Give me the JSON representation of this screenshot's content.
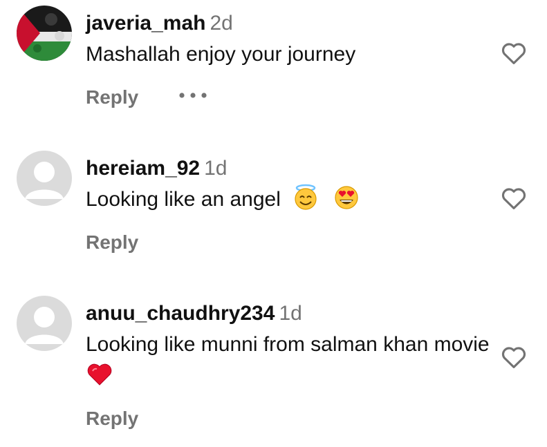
{
  "comments": [
    {
      "username": "javeria_mah",
      "time": "2d",
      "text": "Mashallah enjoy your journey",
      "reply_label": "Reply",
      "avatar": "flag-avatar",
      "has_more": true
    },
    {
      "username": "hereiam_92",
      "time": "1d",
      "text": "Looking like an angel",
      "emojis": [
        "smiling-face-with-halo-emoji",
        "heart-eyes-emoji"
      ],
      "reply_label": "Reply",
      "avatar": "default-avatar"
    },
    {
      "username": "anuu_chaudhry234",
      "time": "1d",
      "text": "Looking like munni from salman khan movie",
      "emojis": [
        "red-heart-emoji"
      ],
      "reply_label": "Reply",
      "avatar": "default-avatar"
    }
  ],
  "icons": {
    "like": "heart-outline-icon",
    "more": "more-options-icon"
  },
  "colors": {
    "text": "#111111",
    "muted": "#737373",
    "icon": "#737373",
    "avatar_bg": "#dbdbdb",
    "emoji_yellow": "#ffc83d",
    "heart_red": "#e8112d"
  }
}
